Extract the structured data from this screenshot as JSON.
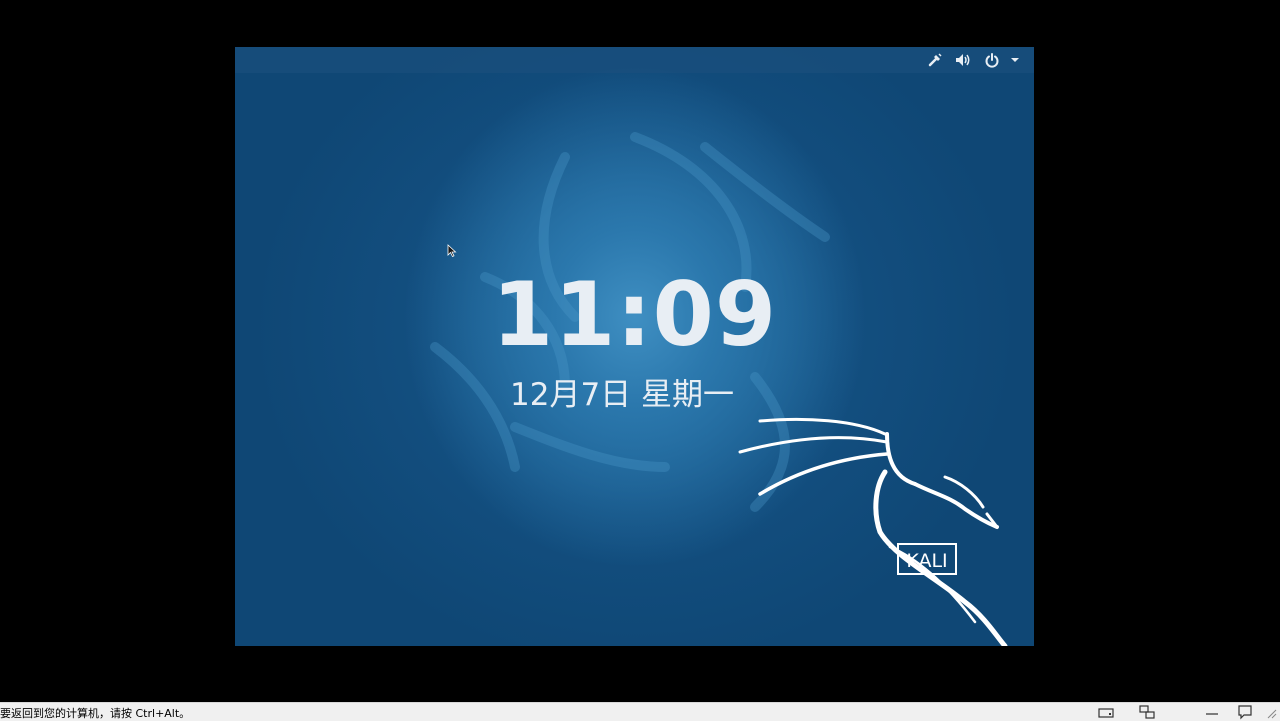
{
  "lock_screen": {
    "time": "11:09",
    "date": "12月7日 星期一"
  },
  "top_bar": {
    "icons": [
      "network-wired-icon",
      "volume-icon",
      "power-icon",
      "chevron-down-icon"
    ]
  },
  "logo": {
    "text": "KALI"
  },
  "status_bar": {
    "message": "要返回到您的计算机，请按 Ctrl+Alt。",
    "icons": [
      "hard-disk-icon",
      "network-adapter-icon",
      "usb-icon",
      "message-icon"
    ]
  },
  "colors": {
    "desktop_dark": "#0f4775",
    "desktop_light": "#3f8fc2",
    "text": "#e8eef4"
  }
}
